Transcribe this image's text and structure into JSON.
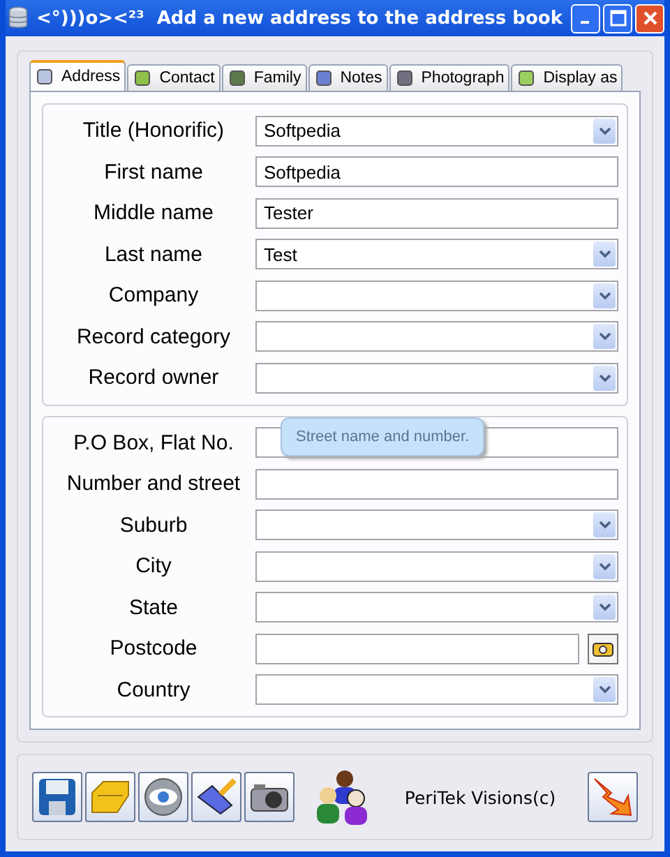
{
  "window": {
    "title": "<°)))o><²³  Add a new address to the address book"
  },
  "tabs": [
    {
      "label": "Address",
      "selected": true
    },
    {
      "label": "Contact",
      "selected": false
    },
    {
      "label": "Family",
      "selected": false
    },
    {
      "label": "Notes",
      "selected": false
    },
    {
      "label": "Photograph",
      "selected": false
    },
    {
      "label": "Display as",
      "selected": false
    }
  ],
  "groups": [
    {
      "fields": [
        {
          "label": "Title (Honorific)",
          "kind": "combo",
          "value": "Softpedia"
        },
        {
          "label": "First name",
          "kind": "text",
          "value": "Softpedia"
        },
        {
          "label": "Middle name",
          "kind": "text",
          "value": "Tester"
        },
        {
          "label": "Last name",
          "kind": "combo",
          "value": "Test"
        },
        {
          "label": "Company",
          "kind": "combo"
        },
        {
          "label": "Record category",
          "kind": "combo"
        },
        {
          "label": "Record owner",
          "kind": "combo"
        }
      ]
    },
    {
      "fields": [
        {
          "label": "P.O Box, Flat No.",
          "kind": "text",
          "tooltip": "Street name and number."
        },
        {
          "label": "Number and street",
          "kind": "text"
        },
        {
          "label": "Suburb",
          "kind": "combo"
        },
        {
          "label": "City",
          "kind": "combo"
        },
        {
          "label": "State",
          "kind": "combo"
        },
        {
          "label": "Postcode",
          "kind": "lookup"
        },
        {
          "label": "Country",
          "kind": "combo"
        }
      ]
    }
  ],
  "footer": {
    "credit": "PeriTek Visions(c)"
  }
}
